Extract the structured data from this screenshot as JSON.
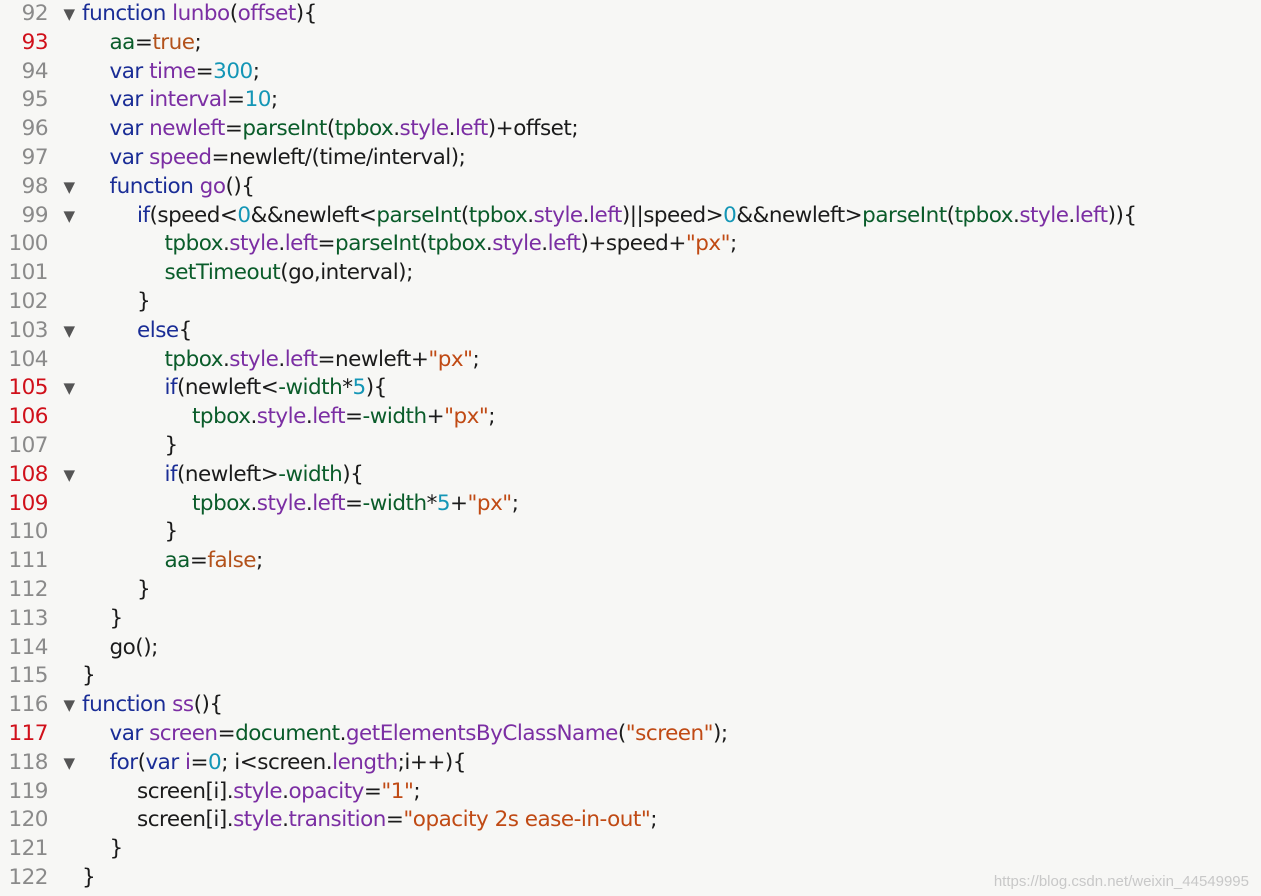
{
  "editor": {
    "lines": [
      {
        "n": "92",
        "hl": false,
        "fold": true,
        "indent": 0,
        "tokens": [
          [
            "kw",
            "function "
          ],
          [
            "fn",
            "lunbo"
          ],
          [
            "tx",
            "("
          ],
          [
            "fn",
            "offset"
          ],
          [
            "tx",
            "){"
          ]
        ]
      },
      {
        "n": "93",
        "hl": true,
        "fold": false,
        "indent": 1,
        "tokens": [
          [
            "id",
            "aa"
          ],
          [
            "op",
            "="
          ],
          [
            "bool",
            "true"
          ],
          [
            "tx",
            ";"
          ]
        ]
      },
      {
        "n": "94",
        "hl": false,
        "fold": false,
        "indent": 1,
        "tokens": [
          [
            "kw",
            "var "
          ],
          [
            "fn",
            "time"
          ],
          [
            "op",
            "="
          ],
          [
            "num",
            "300"
          ],
          [
            "tx",
            ";"
          ]
        ]
      },
      {
        "n": "95",
        "hl": false,
        "fold": false,
        "indent": 1,
        "tokens": [
          [
            "kw",
            "var "
          ],
          [
            "fn",
            "interval"
          ],
          [
            "op",
            "="
          ],
          [
            "num",
            "10"
          ],
          [
            "tx",
            ";"
          ]
        ]
      },
      {
        "n": "96",
        "hl": false,
        "fold": false,
        "indent": 1,
        "tokens": [
          [
            "kw",
            "var "
          ],
          [
            "fn",
            "newleft"
          ],
          [
            "op",
            "="
          ],
          [
            "id",
            "parseInt"
          ],
          [
            "tx",
            "("
          ],
          [
            "id",
            "tpbox"
          ],
          [
            "tx",
            "."
          ],
          [
            "pr",
            "style"
          ],
          [
            "tx",
            "."
          ],
          [
            "pr",
            "left"
          ],
          [
            "tx",
            ")"
          ],
          [
            "op",
            "+"
          ],
          [
            "tx",
            "offset;"
          ]
        ]
      },
      {
        "n": "97",
        "hl": false,
        "fold": false,
        "indent": 1,
        "tokens": [
          [
            "kw",
            "var "
          ],
          [
            "fn",
            "speed"
          ],
          [
            "op",
            "="
          ],
          [
            "tx",
            "newleft/(time/interval);"
          ]
        ]
      },
      {
        "n": "98",
        "hl": false,
        "fold": true,
        "indent": 1,
        "tokens": [
          [
            "kw",
            "function "
          ],
          [
            "fn",
            "go"
          ],
          [
            "tx",
            "(){"
          ]
        ]
      },
      {
        "n": "99",
        "hl": false,
        "fold": true,
        "indent": 2,
        "tokens": [
          [
            "kw",
            "if"
          ],
          [
            "tx",
            "(speed"
          ],
          [
            "op",
            "<"
          ],
          [
            "num",
            "0"
          ],
          [
            "tx",
            "&&newleft"
          ],
          [
            "op",
            "<"
          ],
          [
            "id",
            "parseInt"
          ],
          [
            "tx",
            "("
          ],
          [
            "id",
            "tpbox"
          ],
          [
            "tx",
            "."
          ],
          [
            "pr",
            "style"
          ],
          [
            "tx",
            "."
          ],
          [
            "pr",
            "left"
          ],
          [
            "tx",
            ")||speed"
          ],
          [
            "op",
            ">"
          ],
          [
            "num",
            "0"
          ],
          [
            "tx",
            "&&newleft"
          ],
          [
            "op",
            ">"
          ],
          [
            "id",
            "parseInt"
          ],
          [
            "tx",
            "("
          ],
          [
            "id",
            "tpbox"
          ],
          [
            "tx",
            "."
          ],
          [
            "pr",
            "style"
          ],
          [
            "tx",
            "."
          ],
          [
            "pr",
            "left"
          ],
          [
            "tx",
            "))"
          ],
          [
            "tx",
            "{"
          ]
        ]
      },
      {
        "n": "100",
        "hl": false,
        "fold": false,
        "indent": 3,
        "tokens": [
          [
            "id",
            "tpbox"
          ],
          [
            "tx",
            "."
          ],
          [
            "pr",
            "style"
          ],
          [
            "tx",
            "."
          ],
          [
            "pr",
            "left"
          ],
          [
            "op",
            "="
          ],
          [
            "id",
            "parseInt"
          ],
          [
            "tx",
            "("
          ],
          [
            "id",
            "tpbox"
          ],
          [
            "tx",
            "."
          ],
          [
            "pr",
            "style"
          ],
          [
            "tx",
            "."
          ],
          [
            "pr",
            "left"
          ],
          [
            "tx",
            ")"
          ],
          [
            "op",
            "+"
          ],
          [
            "tx",
            "speed"
          ],
          [
            "op",
            "+"
          ],
          [
            "str",
            "\"px\""
          ],
          [
            "tx",
            ";"
          ]
        ]
      },
      {
        "n": "101",
        "hl": false,
        "fold": false,
        "indent": 3,
        "tokens": [
          [
            "id",
            "setTimeout"
          ],
          [
            "tx",
            "(go,interval);"
          ]
        ]
      },
      {
        "n": "102",
        "hl": false,
        "fold": false,
        "indent": 2,
        "tokens": [
          [
            "tx",
            "}"
          ]
        ]
      },
      {
        "n": "103",
        "hl": false,
        "fold": true,
        "indent": 2,
        "tokens": [
          [
            "kw",
            "else"
          ],
          [
            "tx",
            "{"
          ]
        ]
      },
      {
        "n": "104",
        "hl": false,
        "fold": false,
        "indent": 3,
        "tokens": [
          [
            "id",
            "tpbox"
          ],
          [
            "tx",
            "."
          ],
          [
            "pr",
            "style"
          ],
          [
            "tx",
            "."
          ],
          [
            "pr",
            "left"
          ],
          [
            "op",
            "="
          ],
          [
            "tx",
            "newleft"
          ],
          [
            "op",
            "+"
          ],
          [
            "str",
            "\"px\""
          ],
          [
            "tx",
            ";"
          ]
        ]
      },
      {
        "n": "105",
        "hl": true,
        "fold": true,
        "indent": 3,
        "tokens": [
          [
            "kw",
            "if"
          ],
          [
            "tx",
            "(newleft"
          ],
          [
            "op",
            "<"
          ],
          [
            "id",
            "-width"
          ],
          [
            "op",
            "*"
          ],
          [
            "num",
            "5"
          ],
          [
            "tx",
            "){"
          ]
        ]
      },
      {
        "n": "106",
        "hl": true,
        "fold": false,
        "indent": 4,
        "tokens": [
          [
            "id",
            "tpbox"
          ],
          [
            "tx",
            "."
          ],
          [
            "pr",
            "style"
          ],
          [
            "tx",
            "."
          ],
          [
            "pr",
            "left"
          ],
          [
            "op",
            "="
          ],
          [
            "id",
            "-width"
          ],
          [
            "op",
            "+"
          ],
          [
            "str",
            "\"px\""
          ],
          [
            "tx",
            ";"
          ]
        ]
      },
      {
        "n": "107",
        "hl": false,
        "fold": false,
        "indent": 3,
        "tokens": [
          [
            "tx",
            "}"
          ]
        ]
      },
      {
        "n": "108",
        "hl": true,
        "fold": true,
        "indent": 3,
        "tokens": [
          [
            "kw",
            "if"
          ],
          [
            "tx",
            "(newleft"
          ],
          [
            "op",
            ">"
          ],
          [
            "id",
            "-width"
          ],
          [
            "tx",
            "){"
          ]
        ]
      },
      {
        "n": "109",
        "hl": true,
        "fold": false,
        "indent": 4,
        "tokens": [
          [
            "id",
            "tpbox"
          ],
          [
            "tx",
            "."
          ],
          [
            "pr",
            "style"
          ],
          [
            "tx",
            "."
          ],
          [
            "pr",
            "left"
          ],
          [
            "op",
            "="
          ],
          [
            "id",
            "-width"
          ],
          [
            "op",
            "*"
          ],
          [
            "num",
            "5"
          ],
          [
            "op",
            "+"
          ],
          [
            "str",
            "\"px\""
          ],
          [
            "tx",
            ";"
          ]
        ]
      },
      {
        "n": "110",
        "hl": false,
        "fold": false,
        "indent": 3,
        "tokens": [
          [
            "tx",
            "}"
          ]
        ]
      },
      {
        "n": "111",
        "hl": false,
        "fold": false,
        "indent": 3,
        "tokens": [
          [
            "id",
            "aa"
          ],
          [
            "op",
            "="
          ],
          [
            "bool",
            "false"
          ],
          [
            "tx",
            ";"
          ]
        ]
      },
      {
        "n": "112",
        "hl": false,
        "fold": false,
        "indent": 2,
        "tokens": [
          [
            "tx",
            "}"
          ]
        ]
      },
      {
        "n": "113",
        "hl": false,
        "fold": false,
        "indent": 1,
        "tokens": [
          [
            "tx",
            "}"
          ]
        ]
      },
      {
        "n": "114",
        "hl": false,
        "fold": false,
        "indent": 1,
        "tokens": [
          [
            "tx",
            "go();"
          ]
        ]
      },
      {
        "n": "115",
        "hl": false,
        "fold": false,
        "indent": 0,
        "tokens": [
          [
            "tx",
            "}"
          ]
        ]
      },
      {
        "n": "116",
        "hl": false,
        "fold": true,
        "indent": 0,
        "tokens": [
          [
            "kw",
            "function "
          ],
          [
            "fn",
            "ss"
          ],
          [
            "tx",
            "(){"
          ]
        ]
      },
      {
        "n": "117",
        "hl": true,
        "fold": false,
        "indent": 1,
        "tokens": [
          [
            "kw",
            "var "
          ],
          [
            "fn",
            "screen"
          ],
          [
            "op",
            "="
          ],
          [
            "id",
            "document"
          ],
          [
            "tx",
            "."
          ],
          [
            "pr",
            "getElementsByClassName"
          ],
          [
            "tx",
            "("
          ],
          [
            "str",
            "\"screen\""
          ],
          [
            "tx",
            ");"
          ]
        ]
      },
      {
        "n": "118",
        "hl": false,
        "fold": true,
        "indent": 1,
        "tokens": [
          [
            "kw",
            "for"
          ],
          [
            "tx",
            "("
          ],
          [
            "kw",
            "var "
          ],
          [
            "fn",
            "i"
          ],
          [
            "op",
            "="
          ],
          [
            "num",
            "0"
          ],
          [
            "tx",
            "; i"
          ],
          [
            "op",
            "<"
          ],
          [
            "tx",
            "screen."
          ],
          [
            "pr",
            "length"
          ],
          [
            "tx",
            ";i"
          ],
          [
            "op",
            "++"
          ],
          [
            "tx",
            "){"
          ]
        ]
      },
      {
        "n": "119",
        "hl": false,
        "fold": false,
        "indent": 2,
        "tokens": [
          [
            "tx",
            "screen[i]."
          ],
          [
            "pr",
            "style"
          ],
          [
            "tx",
            "."
          ],
          [
            "pr",
            "opacity"
          ],
          [
            "op",
            "="
          ],
          [
            "str",
            "\"1\""
          ],
          [
            "tx",
            ";"
          ]
        ]
      },
      {
        "n": "120",
        "hl": false,
        "fold": false,
        "indent": 2,
        "tokens": [
          [
            "tx",
            "screen[i]."
          ],
          [
            "pr",
            "style"
          ],
          [
            "tx",
            "."
          ],
          [
            "pr",
            "transition"
          ],
          [
            "op",
            "="
          ],
          [
            "str",
            "\"opacity 2s ease-in-out\""
          ],
          [
            "tx",
            ";"
          ]
        ]
      },
      {
        "n": "121",
        "hl": false,
        "fold": false,
        "indent": 1,
        "tokens": [
          [
            "tx",
            "}"
          ]
        ]
      },
      {
        "n": "122",
        "hl": false,
        "fold": false,
        "indent": 0,
        "tokens": [
          [
            "tx",
            "}"
          ]
        ]
      }
    ],
    "fold_glyph": "▼",
    "watermark": "https://blog.csdn.net/weixin_44549995"
  }
}
